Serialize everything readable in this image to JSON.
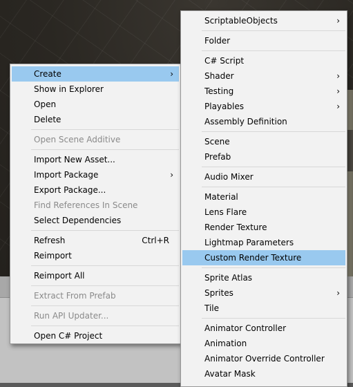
{
  "context_menu": {
    "items": [
      {
        "label": "Create",
        "submenu": true,
        "highlighted": true
      },
      {
        "label": "Show in Explorer"
      },
      {
        "label": "Open"
      },
      {
        "label": "Delete"
      },
      {
        "separator": true
      },
      {
        "label": "Open Scene Additive",
        "disabled": true
      },
      {
        "separator": true
      },
      {
        "label": "Import New Asset..."
      },
      {
        "label": "Import Package",
        "submenu": true
      },
      {
        "label": "Export Package..."
      },
      {
        "label": "Find References In Scene",
        "disabled": true
      },
      {
        "label": "Select Dependencies"
      },
      {
        "separator": true
      },
      {
        "label": "Refresh",
        "shortcut": "Ctrl+R"
      },
      {
        "label": "Reimport"
      },
      {
        "separator": true
      },
      {
        "label": "Reimport All"
      },
      {
        "separator": true
      },
      {
        "label": "Extract From Prefab",
        "disabled": true
      },
      {
        "separator": true
      },
      {
        "label": "Run API Updater...",
        "disabled": true
      },
      {
        "separator": true
      },
      {
        "label": "Open C# Project"
      }
    ]
  },
  "create_submenu": {
    "items": [
      {
        "label": "ScriptableObjects",
        "submenu": true
      },
      {
        "separator": true
      },
      {
        "label": "Folder"
      },
      {
        "separator": true
      },
      {
        "label": "C# Script"
      },
      {
        "label": "Shader",
        "submenu": true
      },
      {
        "label": "Testing",
        "submenu": true
      },
      {
        "label": "Playables",
        "submenu": true
      },
      {
        "label": "Assembly Definition"
      },
      {
        "separator": true
      },
      {
        "label": "Scene"
      },
      {
        "label": "Prefab"
      },
      {
        "separator": true
      },
      {
        "label": "Audio Mixer"
      },
      {
        "separator": true
      },
      {
        "label": "Material"
      },
      {
        "label": "Lens Flare"
      },
      {
        "label": "Render Texture"
      },
      {
        "label": "Lightmap Parameters"
      },
      {
        "label": "Custom Render Texture",
        "highlighted": true
      },
      {
        "separator": true
      },
      {
        "label": "Sprite Atlas"
      },
      {
        "label": "Sprites",
        "submenu": true
      },
      {
        "label": "Tile"
      },
      {
        "separator": true
      },
      {
        "label": "Animator Controller"
      },
      {
        "label": "Animation"
      },
      {
        "label": "Animator Override Controller"
      },
      {
        "label": "Avatar Mask"
      }
    ]
  },
  "icons": {
    "submenu_arrow": "chevron-right-icon"
  },
  "colors": {
    "menu_bg": "#f2f2f2",
    "highlight": "#99c9ef",
    "disabled_text": "#8a8a8a"
  }
}
